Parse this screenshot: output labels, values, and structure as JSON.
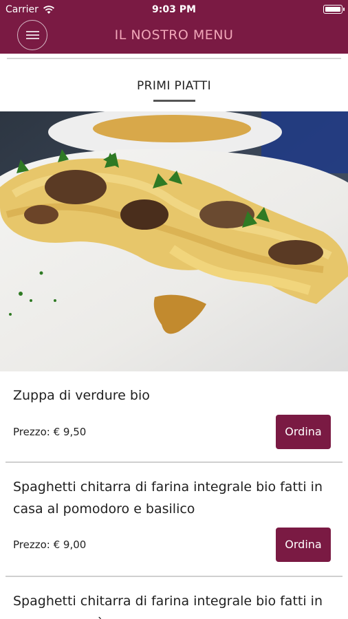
{
  "status": {
    "carrier": "Carrier",
    "time": "9:03 PM"
  },
  "header": {
    "title": "IL NOSTRO MENU",
    "menu_icon": "hamburger-icon"
  },
  "section": {
    "title": "PRIMI PIATTI"
  },
  "hero": {
    "alt": "pasta-dish-photo"
  },
  "items": [
    {
      "name": "Zuppa di verdure bio",
      "price": "Prezzo: € 9,50",
      "button": "Ordina"
    },
    {
      "name": "Spaghetti chitarra di farina integrale bio fatti in casa al pomodoro e basilico",
      "price": "Prezzo: € 9,00",
      "button": "Ordina"
    },
    {
      "name": "Spaghetti chitarra di farina integrale bio fatti in casa con ragù"
    }
  ],
  "colors": {
    "brand": "#7a1a43",
    "title_accent": "#f0a6b8"
  }
}
